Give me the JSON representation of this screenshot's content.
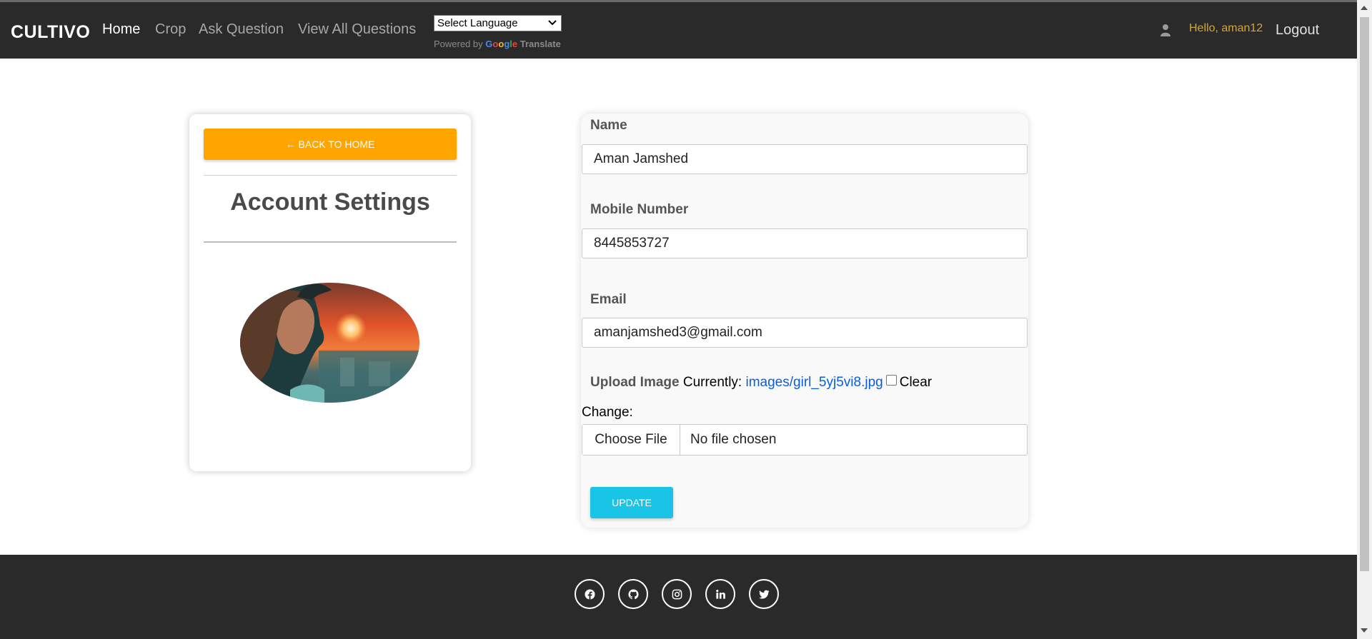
{
  "nav": {
    "brand": "CULTIVO",
    "links": [
      "Home",
      "Crop",
      "Ask Question",
      "View All Questions"
    ],
    "language_select": "Select Language",
    "powered_by": "Powered by",
    "google": [
      "G",
      "o",
      "o",
      "g",
      "l",
      "e"
    ],
    "translate": "Translate",
    "greeting": "Hello, aman12",
    "logout": "Logout"
  },
  "left_card": {
    "back_button": "← BACK TO HOME",
    "title": "Account Settings"
  },
  "form": {
    "name_label": "Name",
    "name_value": "Aman Jamshed",
    "mobile_label": "Mobile Number",
    "mobile_value": "8445853727",
    "email_label": "Email",
    "email_value": "amanjamshed3@gmail.com",
    "upload_label": "Upload Image",
    "currently_label": "Currently:",
    "current_image": "images/girl_5yj5vi8.jpg",
    "clear_label": "Clear",
    "change_label": "Change:",
    "choose_file": "Choose File",
    "no_file": "No file chosen",
    "update_button": "UPDATE"
  },
  "footer": {
    "social_icons": [
      "facebook-icon",
      "github-icon",
      "instagram-icon",
      "linkedin-icon",
      "twitter-icon"
    ]
  },
  "colors": {
    "navbar_bg": "#2a2a2a",
    "back_button": "#ffa500",
    "update_button": "#1ac4e7",
    "greeting": "#d4a72c",
    "link": "#0b5ed7"
  }
}
